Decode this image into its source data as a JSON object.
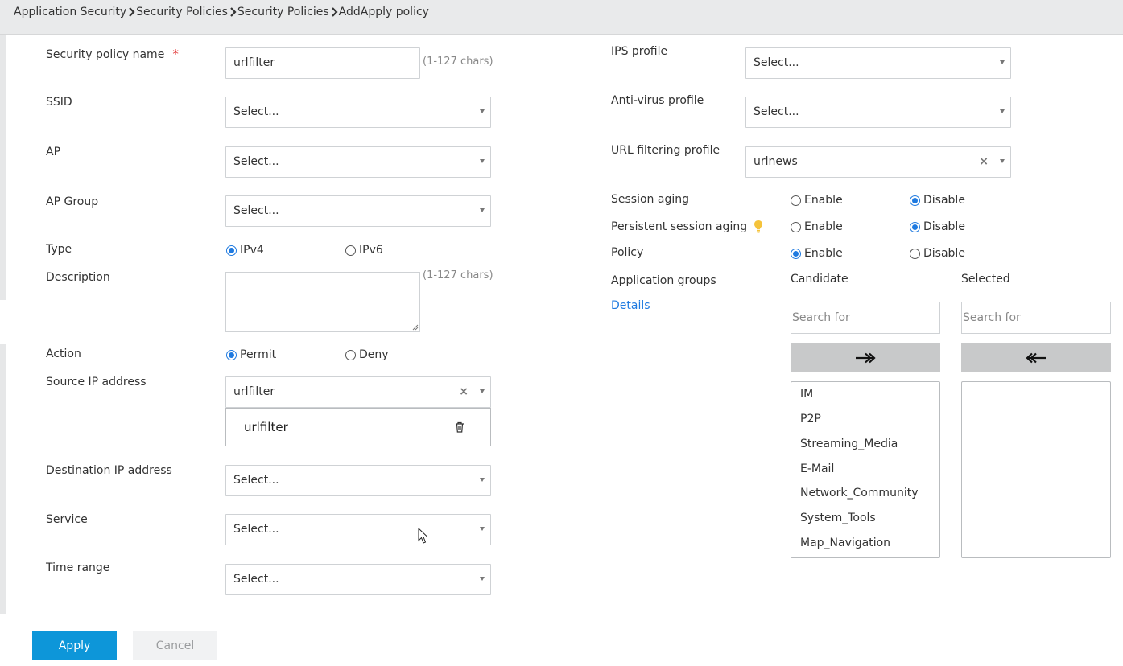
{
  "breadcrumb": [
    "Application Security",
    "Security Policies",
    "Security Policies",
    "AddApply policy"
  ],
  "left": {
    "policy_name": {
      "label": "Security policy name",
      "required_mark": "*",
      "value": "urlfilter",
      "hint": "(1-127 chars)"
    },
    "ssid": {
      "label": "SSID",
      "value": "Select..."
    },
    "ap": {
      "label": "AP",
      "value": "Select..."
    },
    "ap_group": {
      "label": "AP Group",
      "value": "Select..."
    },
    "type": {
      "label": "Type",
      "options": [
        "IPv4",
        "IPv6"
      ],
      "selected": "IPv4"
    },
    "description": {
      "label": "Description",
      "hint": "(1-127 chars)"
    },
    "action": {
      "label": "Action",
      "options": [
        "Permit",
        "Deny"
      ],
      "selected": "Permit"
    },
    "source_ip": {
      "label": "Source IP address",
      "value": "urlfilter",
      "chip": "urlfilter"
    },
    "dest_ip": {
      "label": "Destination IP address",
      "value": "Select..."
    },
    "service": {
      "label": "Service",
      "value": "Select..."
    },
    "time_range": {
      "label": "Time range",
      "value": "Select..."
    }
  },
  "right": {
    "ips_profile": {
      "label": "IPS profile",
      "value": "Select..."
    },
    "antivirus_profile": {
      "label": "Anti-virus profile",
      "value": "Select..."
    },
    "url_filtering_profile": {
      "label": "URL filtering profile",
      "value": "urlnews"
    },
    "session_aging": {
      "label": "Session aging",
      "options": [
        "Enable",
        "Disable"
      ],
      "selected": "Disable"
    },
    "persistent_session_aging": {
      "label": "Persistent session aging",
      "options": [
        "Enable",
        "Disable"
      ],
      "selected": "Disable"
    },
    "policy": {
      "label": "Policy",
      "options": [
        "Enable",
        "Disable"
      ],
      "selected": "Enable"
    },
    "application_groups": {
      "label": "Application groups",
      "details_link": "Details",
      "candidate_title": "Candidate",
      "selected_title": "Selected",
      "search_placeholder": "Search for",
      "candidate_items": [
        "IM",
        "P2P",
        "Streaming_Media",
        "E-Mail",
        "Network_Community",
        "System_Tools",
        "Map_Navigation"
      ],
      "selected_items": []
    }
  },
  "footer": {
    "apply_label": "Apply",
    "cancel_label": "Cancel"
  },
  "colors": {
    "accent": "#1f7ae0",
    "apply_button": "#0d96d9",
    "required": "#e23a3a"
  }
}
